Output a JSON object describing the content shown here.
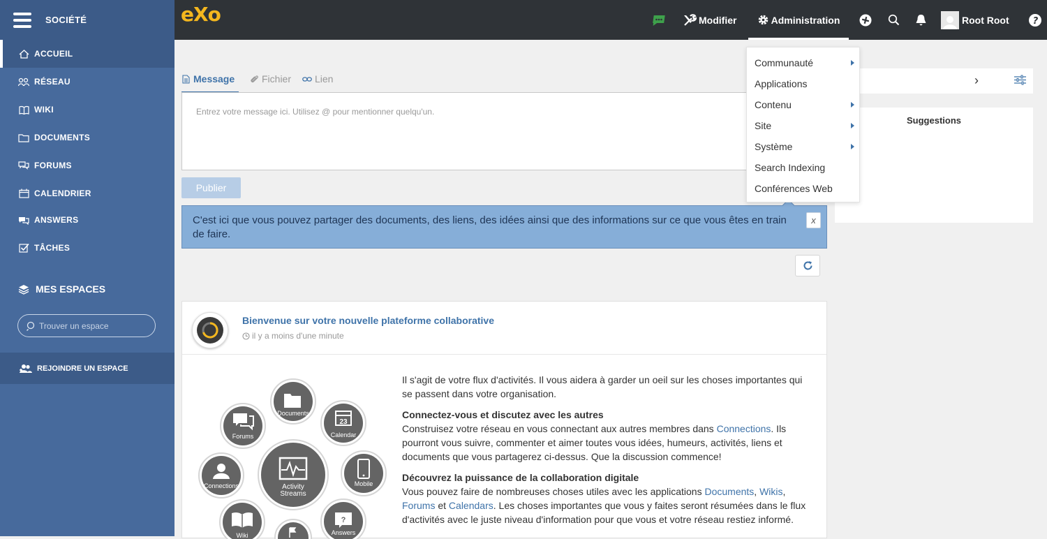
{
  "sidebar": {
    "company": "SOCIÉTÉ",
    "items": [
      {
        "label": "ACCUEIL",
        "icon": "home-icon"
      },
      {
        "label": "RÉSEAU",
        "icon": "network-icon"
      },
      {
        "label": "WIKI",
        "icon": "wiki-icon"
      },
      {
        "label": "DOCUMENTS",
        "icon": "folder-icon"
      },
      {
        "label": "FORUMS",
        "icon": "forum-icon"
      },
      {
        "label": "CALENDRIER",
        "icon": "calendar-icon"
      },
      {
        "label": "ANSWERS",
        "icon": "answers-icon"
      },
      {
        "label": "TÂCHES",
        "icon": "tasks-icon"
      }
    ],
    "spaces_title": "MES ESPACES",
    "space_search_placeholder": "Trouver un espace",
    "join_space": "REJOINDRE UN ESPACE"
  },
  "topbar": {
    "logo": "eXo",
    "edit_label": "Modifier",
    "admin_label": "Administration",
    "user_name": "Root Root"
  },
  "admin_menu": [
    {
      "label": "Communauté",
      "submenu": true
    },
    {
      "label": "Applications",
      "submenu": false
    },
    {
      "label": "Contenu",
      "submenu": true
    },
    {
      "label": "Site",
      "submenu": true
    },
    {
      "label": "Système",
      "submenu": true
    },
    {
      "label": "Search Indexing",
      "submenu": false
    },
    {
      "label": "Conférences Web",
      "submenu": false
    }
  ],
  "composer": {
    "tabs": [
      "Message",
      "Fichier",
      "Lien"
    ],
    "placeholder": "Entrez votre message ici. Utilisez @ pour mentionner quelqu'un.",
    "publish": "Publier"
  },
  "tip": {
    "text": "C'est ici que vous pouvez partager des documents, des liens, des idées ainsi que des informations sur ce que vous êtes en train de faire.",
    "close": "x"
  },
  "activity": {
    "title": "Bienvenue sur votre nouvelle plateforme collaborative",
    "time": "il y a moins d'une minute",
    "intro": "Il s'agit de votre flux d'activités. Il vous aidera à garder un oeil sur les choses importantes qui se passent dans votre organisation.",
    "h1": "Connectez-vous et discutez avec les autres",
    "p1_before": "Construisez votre réseau en vous connectant aux autres membres dans ",
    "p1_link": "Connections",
    "p1_after": ". Ils pourront vous suivre, commenter et aimer toutes vous idées, humeurs, activités, liens et documents que vous partagerez ci-dessus. Que la discussion commence!",
    "h2": "Découvrez la puissance de la collaboration digitale",
    "p2_before": "Vous pouvez faire de nombreuses choses utiles avec les applications ",
    "p2_link1": "Documents",
    "p2_sep1": ", ",
    "p2_link2": "Wikis",
    "p2_sep2": ", ",
    "p2_link3": "Forums",
    "p2_sep3": " et ",
    "p2_link4": "Calendars",
    "p2_after": ". Les choses importantes que vous y faites seront résumées dans le flux d'activités avec le juste niveau d'information pour que vous et votre réseau restiez informé.",
    "diagram": {
      "center": [
        "Activity",
        "Streams"
      ],
      "documents": "Documents",
      "calendar": "Calendar",
      "calendar_day": "23",
      "forums": "Forums",
      "connections": "Connections",
      "mobile": "Mobile",
      "wiki": "Wiki",
      "answers": "Answers"
    }
  },
  "right": {
    "suggestions": "Suggestions",
    "chevron": "›"
  },
  "colors": {
    "sidebar": "#476a9c",
    "topbar": "#2f3337",
    "accent": "#3f73a9",
    "logo": "#f4b71e"
  }
}
